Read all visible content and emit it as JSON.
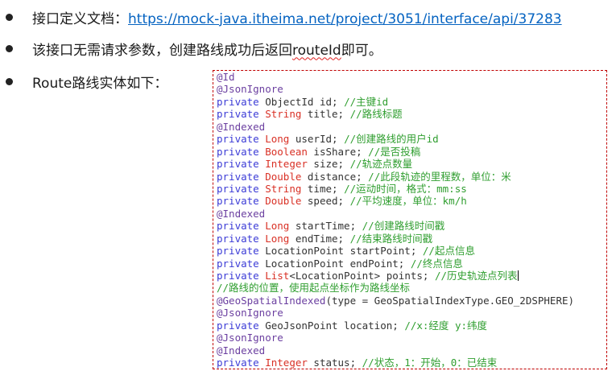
{
  "bullets": {
    "doc_label": "接口定义文档：",
    "doc_link": "https://mock-java.itheima.net/project/3051/interface/api/37283",
    "note_before": "该接口无需请求参数，创建路线成功后返回",
    "note_route_id": "routeId",
    "note_after": "即可。",
    "entity_label": "Route路线实体如下："
  },
  "code": [
    [
      [
        "ann",
        "@Id"
      ]
    ],
    [
      [
        "ann",
        "@JsonIgnore"
      ]
    ],
    [
      [
        "kw",
        "private "
      ],
      [
        "plain",
        "ObjectId id; "
      ],
      [
        "cmt",
        "//主键id"
      ]
    ],
    [
      [
        "kw",
        "private "
      ],
      [
        "ty",
        "String"
      ],
      [
        "plain",
        " title; "
      ],
      [
        "cmt",
        "//路线标题"
      ]
    ],
    [
      [
        "ann",
        "@Indexed"
      ]
    ],
    [
      [
        "kw",
        "private "
      ],
      [
        "ty",
        "Long"
      ],
      [
        "plain",
        " userId; "
      ],
      [
        "cmt",
        "//创建路线的用户id"
      ]
    ],
    [
      [
        "kw",
        "private "
      ],
      [
        "ty",
        "Boolean"
      ],
      [
        "plain",
        " isShare; "
      ],
      [
        "cmt",
        "//是否投稿"
      ]
    ],
    [
      [
        "kw",
        "private "
      ],
      [
        "ty",
        "Integer"
      ],
      [
        "plain",
        " size; "
      ],
      [
        "cmt",
        "//轨迹点数量"
      ]
    ],
    [
      [
        "kw",
        "private "
      ],
      [
        "ty",
        "Double"
      ],
      [
        "plain",
        " distance; "
      ],
      [
        "cmt",
        "//此段轨迹的里程数，单位：米"
      ]
    ],
    [
      [
        "kw",
        "private "
      ],
      [
        "ty",
        "String"
      ],
      [
        "plain",
        " time; "
      ],
      [
        "cmt",
        "//运动时间，格式：mm:ss"
      ]
    ],
    [
      [
        "kw",
        "private "
      ],
      [
        "ty",
        "Double"
      ],
      [
        "plain",
        " speed; "
      ],
      [
        "cmt",
        "//平均速度，单位：km/h"
      ]
    ],
    [
      [
        "ann",
        "@Indexed"
      ]
    ],
    [
      [
        "kw",
        "private "
      ],
      [
        "ty",
        "Long"
      ],
      [
        "plain",
        " startTime; "
      ],
      [
        "cmt",
        "//创建路线时间戳"
      ]
    ],
    [
      [
        "kw",
        "private "
      ],
      [
        "ty",
        "Long"
      ],
      [
        "plain",
        " endTime; "
      ],
      [
        "cmt",
        "//结束路线时间戳"
      ]
    ],
    [
      [
        "kw",
        "private "
      ],
      [
        "plain",
        "LocationPoint startPoint; "
      ],
      [
        "cmt",
        "//起点信息"
      ]
    ],
    [
      [
        "kw",
        "private "
      ],
      [
        "plain",
        "LocationPoint endPoint; "
      ],
      [
        "cmt",
        "//终点信息"
      ]
    ],
    [
      [
        "kw",
        "private "
      ],
      [
        "ty",
        "List"
      ],
      [
        "plain",
        "<LocationPoint> points; "
      ],
      [
        "cmt",
        "//历史轨迹点列表"
      ],
      [
        "caret",
        ""
      ]
    ],
    [
      [
        "cmt",
        "//路线的位置，使用起点坐标作为路线坐标"
      ]
    ],
    [
      [
        "ann",
        "@GeoSpatialIndexed"
      ],
      [
        "plain",
        "(type = GeoSpatialIndexType.GEO_2DSPHERE)"
      ]
    ],
    [
      [
        "ann",
        "@JsonIgnore"
      ]
    ],
    [
      [
        "kw",
        "private "
      ],
      [
        "plain",
        "GeoJsonPoint location; "
      ],
      [
        "cmt",
        "//x:经度 y:纬度"
      ]
    ],
    [
      [
        "ann",
        "@JsonIgnore"
      ]
    ],
    [
      [
        "ann",
        "@Indexed"
      ]
    ],
    [
      [
        "kw",
        "private "
      ],
      [
        "ty",
        "Integer"
      ],
      [
        "plain",
        " status; "
      ],
      [
        "cmt",
        "//状态，1：开始，0：已结束"
      ]
    ]
  ]
}
